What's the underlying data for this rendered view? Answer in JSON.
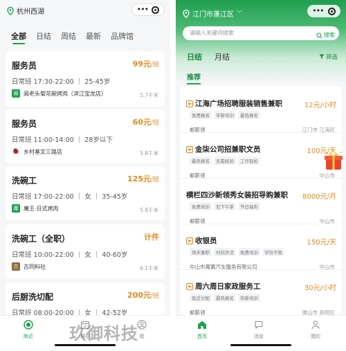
{
  "left": {
    "location": "杭州西湖",
    "tabs": [
      "全部",
      "日结",
      "周结",
      "最新",
      "品牌馆"
    ],
    "cards": [
      {
        "title": "服务员",
        "salary": "99元",
        "unit": "/班",
        "meta": "日常班 17:30-22:00 ｜ 25-45岁",
        "shop": "阆老头菊花碗烤肉（滨江宝龙店）",
        "distance": "5.7千米",
        "logo_char": "阆",
        "logo_color": "#1f9e4e"
      },
      {
        "title": "服务员",
        "salary": "60元",
        "unit": "/班",
        "meta": "日常班 11:00-14:00 ｜ 28岁以下",
        "shop": "乡村基文三路店",
        "distance": "5.8千米",
        "logo_char": "乡",
        "logo_color": "#d9342b"
      },
      {
        "title": "洗碗工",
        "salary": "125元",
        "unit": "/班",
        "meta": "日常班 17:00-22:00 ｜ 女 ｜ 35-45岁",
        "shop": "魔王·日式烤肉",
        "distance": "5.8千米",
        "logo_char": "魔",
        "logo_color": "#1d9a5a"
      },
      {
        "title": "洗碗工（全职）",
        "salary": "计件",
        "unit": "",
        "meta": "日常班 10:00-22:00 ｜ 女 ｜ 40-60岁",
        "shop": "古同料社",
        "distance": "6.1千米",
        "logo_char": "古",
        "logo_color": "#8a6a3a"
      },
      {
        "title": "后厨洗切配",
        "salary": "200元",
        "unit": "/班",
        "meta": "日常班 08:00-20:00 ｜ 女 ｜ 42-52岁",
        "shop": "",
        "distance": "",
        "logo_char": "",
        "logo_color": "#ffffff"
      }
    ],
    "nav": [
      {
        "label": "附近",
        "icon": "nearby-icon",
        "active": true
      },
      {
        "label": "排班",
        "icon": "schedule-icon",
        "active": false
      },
      {
        "label": "我",
        "icon": "profile-icon",
        "active": false
      }
    ]
  },
  "right": {
    "location": "江门市蓬江区",
    "search_placeholder": "请输入关键词搜索",
    "search_button": "搜索",
    "tabs": [
      "日结",
      "月结"
    ],
    "filter": "筛选",
    "section": "推荐",
    "jobs": [
      {
        "title": "江海广场招聘服装销售兼职",
        "pay": "12元/小时",
        "tags": [
          "免费报名",
          "带薪培训",
          "最低报名"
        ],
        "company": "邮薪领",
        "area": "江门市 江海区",
        "badge": true
      },
      {
        "title": "金柒公司招兼职文员",
        "pay": "100元/天",
        "tags": [
          "最热报名",
          "无需经验",
          "工作轻松"
        ],
        "company": "邮薪领",
        "area": "中山市",
        "badge": true
      },
      {
        "title": "横栏四沙新领秀女装招导购兼职",
        "pay": "8000元/月",
        "tags": [
          "免费培训",
          "包下午茶",
          "节日福利"
        ],
        "company": "邮薪领",
        "area": "中山市",
        "badge": false
      },
      {
        "title": "收银员",
        "pay": "150元/天",
        "tags": [
          "周末兼职",
          "时间灵活",
          "免费培训",
          "学历不限"
        ],
        "company": "中山市寓寓汽车服务有限公司",
        "area": "中山市",
        "badge": true
      },
      {
        "title": "周六周日家政服务工",
        "pay": "30元/小时",
        "tags": [
          "就近分配",
          "最热报名",
          "带薪培训"
        ],
        "company": "邮薪领",
        "area": "佛山市 高明区",
        "badge": true
      }
    ],
    "nav": [
      {
        "label": "首页",
        "icon": "home-icon",
        "active": true
      },
      {
        "label": "消息",
        "icon": "message-icon",
        "active": false
      },
      {
        "label": "我的",
        "icon": "profile-icon",
        "active": false
      }
    ],
    "watermark": "玖御科技"
  },
  "colors": {
    "brand_green": "#1aa34a",
    "salary_orange": "#e08a1e"
  }
}
